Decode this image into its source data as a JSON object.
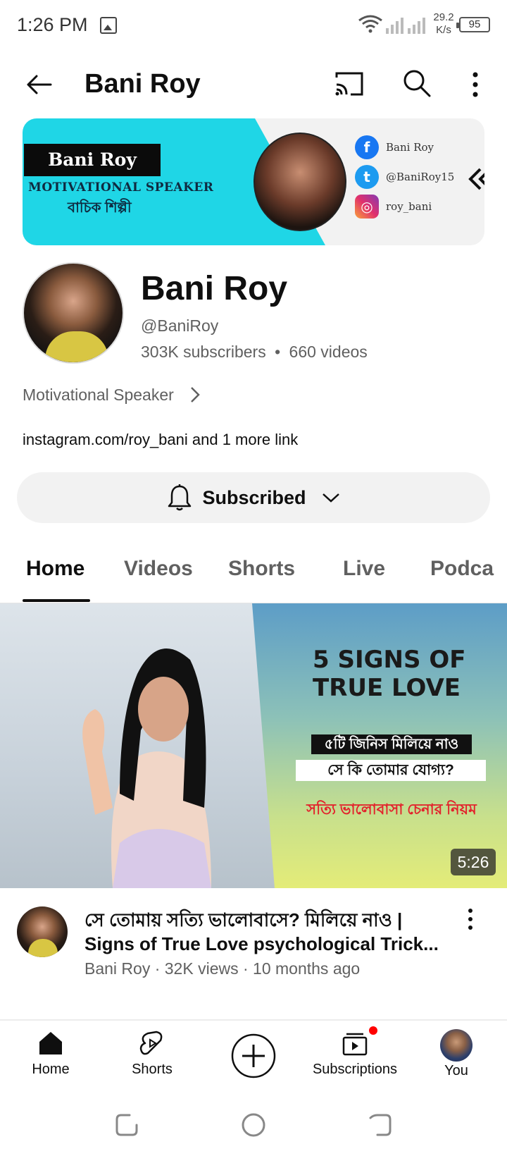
{
  "status_bar": {
    "time": "1:26 PM",
    "speed_value": "29.2",
    "speed_unit": "K/s",
    "battery": "95"
  },
  "app_bar": {
    "title": "Bani Roy"
  },
  "banner": {
    "name": "Bani Roy",
    "tagline": "MOTIVATIONAL SPEAKER",
    "bengali_subtitle": "বাচিক শিল্পী",
    "facebook": "Bani Roy",
    "twitter": "@BaniRoy15",
    "instagram": "roy_bani",
    "accent_color": "#1fd6e6"
  },
  "channel": {
    "name": "Bani Roy",
    "handle": "@BaniRoy",
    "subscribers": "303K subscribers",
    "separator": "•",
    "videos": "660 videos",
    "description": "Motivational Speaker",
    "links": "instagram.com/roy_bani and 1 more link",
    "subscribe_label": "Subscribed"
  },
  "tabs": [
    {
      "label": "Home"
    },
    {
      "label": "Videos"
    },
    {
      "label": "Shorts"
    },
    {
      "label": "Live"
    },
    {
      "label": "Podca"
    }
  ],
  "video": {
    "thumb_title_line1": "5 SIGNS OF",
    "thumb_title_line2": "TRUE LOVE",
    "thumb_box1": "৫টি জিনিস মিলিয়ে নাও",
    "thumb_box2": "সে কি তোমার যোগ্য?",
    "thumb_red": "সত্যি ভালোবাসা চেনার নিয়ম",
    "duration": "5:26",
    "title_line1": "সে তোমায় সত্যি ভালোবাসে?  মিলিয়ে নাও |",
    "title_line2": "Signs of True Love psychological Trick...",
    "meta": "Bani Roy · 32K views · 10 months ago"
  },
  "bottom_nav": {
    "home": "Home",
    "shorts": "Shorts",
    "subscriptions": "Subscriptions",
    "you": "You"
  }
}
